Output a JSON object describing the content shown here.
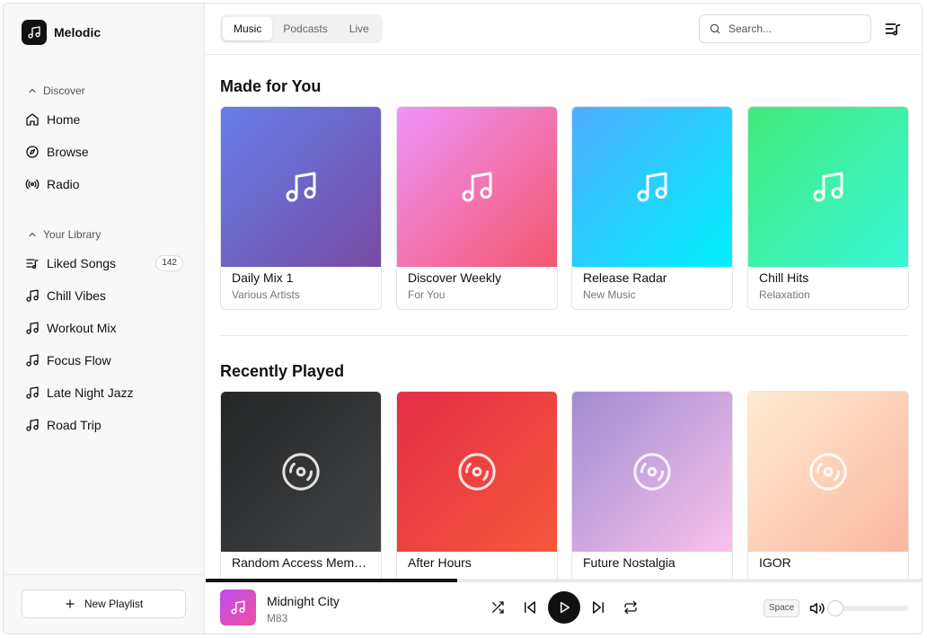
{
  "app": {
    "name": "Melodic"
  },
  "sidebar": {
    "discover_label": "Discover",
    "discover_items": [
      {
        "label": "Home",
        "icon": "home-icon"
      },
      {
        "label": "Browse",
        "icon": "compass-icon"
      },
      {
        "label": "Radio",
        "icon": "radio-icon"
      }
    ],
    "library_label": "Your Library",
    "library_items": [
      {
        "label": "Liked Songs",
        "icon": "list-music-icon",
        "count": "142"
      },
      {
        "label": "Chill Vibes",
        "icon": "music-note-icon"
      },
      {
        "label": "Workout Mix",
        "icon": "music-note-icon"
      },
      {
        "label": "Focus Flow",
        "icon": "music-note-icon"
      },
      {
        "label": "Late Night Jazz",
        "icon": "music-note-icon"
      },
      {
        "label": "Road Trip",
        "icon": "music-note-icon"
      }
    ],
    "new_playlist_label": "New Playlist"
  },
  "header": {
    "tabs": [
      "Music",
      "Podcasts",
      "Live"
    ],
    "active_tab": "Music",
    "search_placeholder": "Search..."
  },
  "sections": [
    {
      "title": "Made for You",
      "cards": [
        {
          "title": "Daily Mix 1",
          "subtitle": "Various Artists",
          "colors": [
            "#667eea",
            "#764ba2"
          ],
          "icon": "music-note-icon"
        },
        {
          "title": "Discover Weekly",
          "subtitle": "For You",
          "colors": [
            "#f093fb",
            "#f5576c"
          ],
          "icon": "music-note-icon"
        },
        {
          "title": "Release Radar",
          "subtitle": "New Music",
          "colors": [
            "#4facfe",
            "#00f2fe"
          ],
          "icon": "music-note-icon"
        },
        {
          "title": "Chill Hits",
          "subtitle": "Relaxation",
          "colors": [
            "#43e97b",
            "#38f9d7"
          ],
          "icon": "music-note-icon"
        }
      ]
    },
    {
      "title": "Recently Played",
      "cards": [
        {
          "title": "Random Access Memories",
          "subtitle": "",
          "colors": [
            "#232526",
            "#414345"
          ],
          "icon": "disc-icon"
        },
        {
          "title": "After Hours",
          "subtitle": "",
          "colors": [
            "#e52d47",
            "#f5583a"
          ],
          "icon": "disc-icon"
        },
        {
          "title": "Future Nostalgia",
          "subtitle": "",
          "colors": [
            "#a18cd1",
            "#fbc2eb"
          ],
          "icon": "disc-icon"
        },
        {
          "title": "IGOR",
          "subtitle": "",
          "colors": [
            "#ffecd2",
            "#fcb69f"
          ],
          "icon": "disc-icon"
        }
      ]
    }
  ],
  "player": {
    "title": "Midnight City",
    "artist": "M83",
    "progress_fraction": 0.35,
    "shortcut_hint": "Space",
    "volume_fraction": 0.0
  }
}
